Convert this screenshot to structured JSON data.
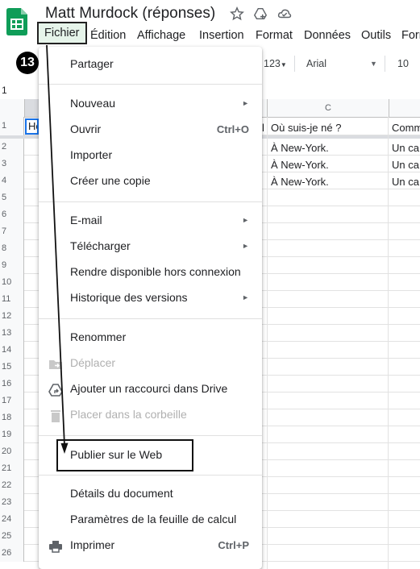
{
  "doc": {
    "title": "Matt Murdock (réponses)"
  },
  "menubar": [
    "Fichier",
    "Édition",
    "Affichage",
    "Insertion",
    "Format",
    "Données",
    "Outils",
    "Forr"
  ],
  "toolbar": {
    "number_format": "123",
    "font": "Arial",
    "font_size": "10"
  },
  "step_badge": "13",
  "formula_cell_ref": "1",
  "sheet": {
    "col_c_header": "C",
    "row_numbers": [
      "1",
      "2",
      "3",
      "4",
      "5",
      "6",
      "7",
      "8",
      "9",
      "10",
      "11",
      "12",
      "13",
      "14",
      "15",
      "16",
      "17",
      "18",
      "19",
      "20",
      "21",
      "22",
      "23",
      "24",
      "25",
      "26"
    ],
    "a1": "Ho",
    "b1_tail": "l",
    "c_values": [
      "Où suis-je né ?",
      "À New-York.",
      "À New-York.",
      "À New-York."
    ],
    "d_values": [
      "Comm",
      "Un ca",
      "Un ca",
      "Un ca"
    ]
  },
  "file_menu": {
    "items": {
      "share": "Partager",
      "new": "Nouveau",
      "open": "Ouvrir",
      "open_shortcut": "Ctrl+O",
      "import": "Importer",
      "copy": "Créer une copie",
      "email": "E-mail",
      "download": "Télécharger",
      "offline": "Rendre disponible hors connexion",
      "history": "Historique des versions",
      "rename": "Renommer",
      "move": "Déplacer",
      "shortcut": "Ajouter un raccourci dans Drive",
      "trash": "Placer dans la corbeille",
      "publish": "Publier sur le Web",
      "details": "Détails du document",
      "settings": "Paramètres de la feuille de calcul",
      "print": "Imprimer",
      "print_shortcut": "Ctrl+P"
    }
  },
  "colors": {
    "sheets_green": "#0f9d58",
    "active_menu_bg": "#e6f4ea"
  }
}
